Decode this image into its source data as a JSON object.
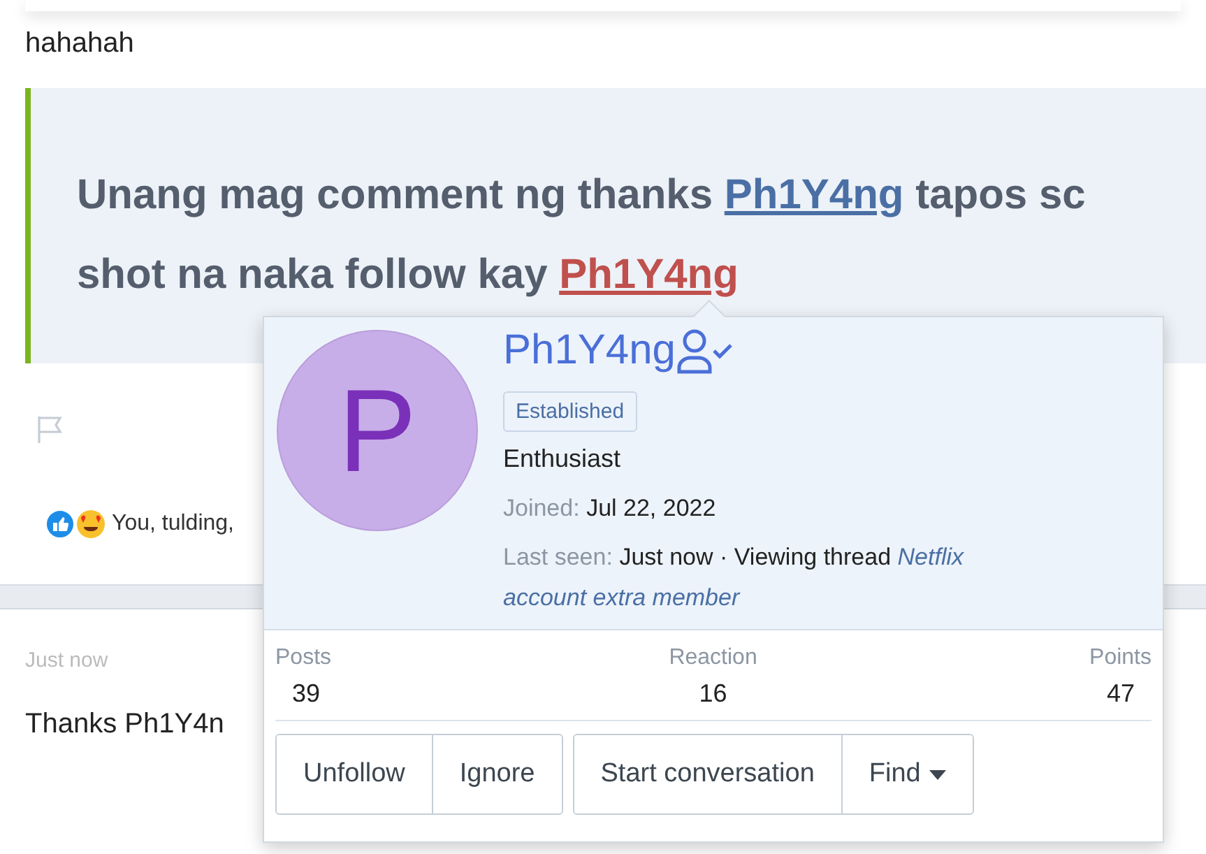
{
  "post_text": "hahahah",
  "quote": {
    "lines": [
      [
        {
          "kind": "text",
          "text": "Unang mag comment ng thanks "
        },
        {
          "kind": "link",
          "text": "Ph1Y4ng",
          "color": "#4a6fa5"
        },
        {
          "kind": "text",
          "text": " tapos sc"
        }
      ],
      [
        {
          "kind": "text",
          "text": "shot na naka follow kay "
        },
        {
          "kind": "link",
          "text": "Ph1Y4ng",
          "color": "#c0504d"
        }
      ]
    ]
  },
  "reactions": {
    "text": "You, tulding,"
  },
  "next_post": {
    "time": "Just now",
    "text": "Thanks Ph1Y4n"
  },
  "member_card": {
    "avatar_letter": "P",
    "name": "Ph1Y4ng",
    "following": true,
    "banner": "Established",
    "title": "Enthusiast",
    "joined": {
      "label": "Joined:",
      "value": "Jul 22, 2022"
    },
    "last_seen": {
      "label": "Last seen:",
      "value": "Just now · Viewing thread ",
      "link": [
        "Netflix",
        "account extra member"
      ]
    },
    "stats": [
      {
        "label": "Posts",
        "value": "39"
      },
      {
        "label": "Reaction",
        "value": "16"
      },
      {
        "label": "Points",
        "value": "47"
      }
    ],
    "button_groups": [
      [
        {
          "label": "Unfollow"
        },
        {
          "label": "Ignore"
        }
      ],
      [
        {
          "label": "Start conversation"
        },
        {
          "label": "Find",
          "dropdown": true
        }
      ]
    ]
  }
}
